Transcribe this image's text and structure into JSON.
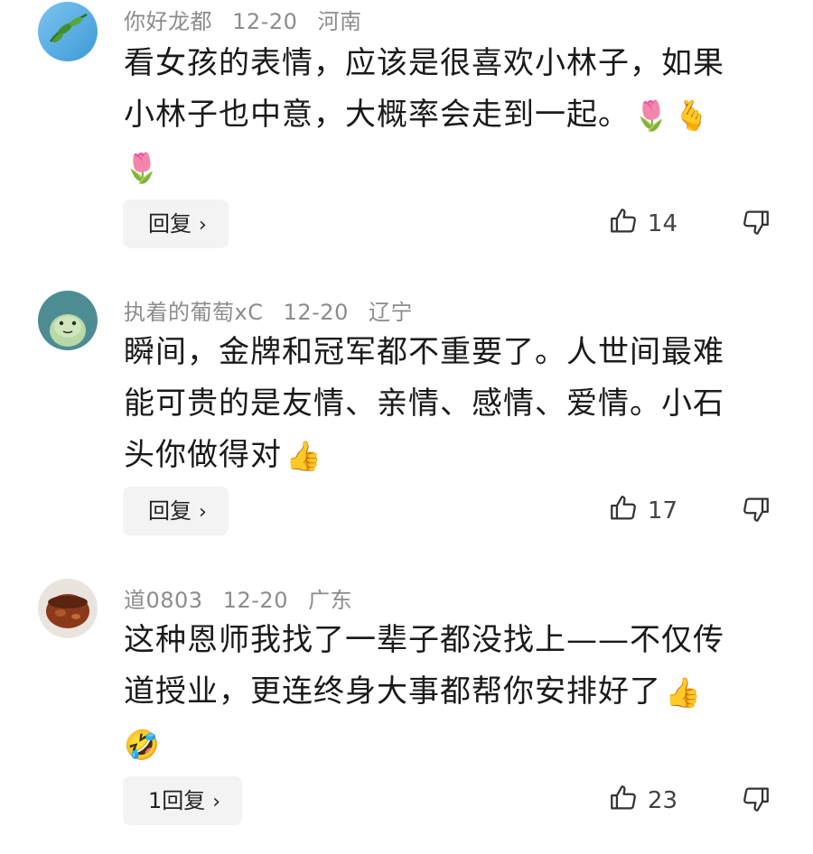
{
  "comments": [
    {
      "user": "你好龙都",
      "date": "12-20",
      "location": "河南",
      "lines": [
        "看女孩的表情，应该是很喜欢小林子，如果",
        "小林子也中意，大概率会走到一起。"
      ],
      "emojis_line2": [
        "🌷",
        "🫰"
      ],
      "emojis_line3": [
        "🌷"
      ],
      "reply_label": "回复",
      "likes": "14"
    },
    {
      "user": "执着的葡萄xC",
      "date": "12-20",
      "location": "辽宁",
      "lines": [
        "瞬间，金牌和冠军都不重要了。人世间最难",
        "能可贵的是友情、亲情、感情、爱情。小石",
        "头你做得对"
      ],
      "emojis_line3": [
        "👍"
      ],
      "reply_label": "回复",
      "likes": "17"
    },
    {
      "user": "道0803",
      "date": "12-20",
      "location": "广东",
      "lines": [
        "这种恩师我找了一辈子都没找上——不仅传",
        "道授业，更连终身大事都帮你安排好了"
      ],
      "emojis_line2": [
        "👍"
      ],
      "emojis_line3": [
        "🤣"
      ],
      "reply_label": "1回复",
      "likes": "23"
    }
  ],
  "icons": {
    "like": "thumbs-up-outline-icon",
    "dislike": "thumbs-down-outline-icon",
    "chevron": "chevron-right-icon"
  },
  "colors": {
    "meta_text": "#8c8c8c",
    "reply_bg": "#f3f3f3"
  }
}
